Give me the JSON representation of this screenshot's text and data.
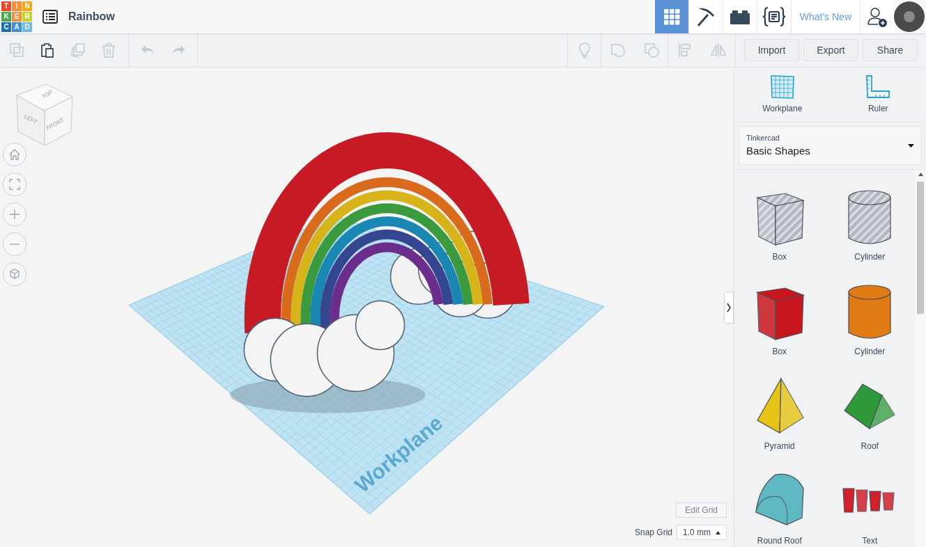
{
  "logo": {
    "letters": [
      "T",
      "I",
      "N",
      "K",
      "E",
      "R",
      "C",
      "A",
      "D"
    ]
  },
  "design_title": "Rainbow",
  "nav_tabs": [
    {
      "kind": "grid",
      "selected": true
    },
    {
      "kind": "pickaxe",
      "selected": false
    },
    {
      "kind": "brick",
      "selected": false
    },
    {
      "kind": "code",
      "selected": false
    }
  ],
  "whats_new": "What's New",
  "edit_tools": [
    {
      "kind": "copy",
      "disabled": true
    },
    {
      "kind": "paste",
      "disabled": false
    },
    {
      "kind": "duplicate",
      "disabled": true
    },
    {
      "kind": "delete",
      "disabled": true
    },
    {
      "kind": "undo",
      "disabled": true
    },
    {
      "kind": "redo",
      "disabled": true
    }
  ],
  "shape_tools": [
    {
      "kind": "bulb",
      "disabled": true
    },
    {
      "kind": "group",
      "disabled": true
    },
    {
      "kind": "ungroup",
      "disabled": true
    },
    {
      "kind": "align",
      "disabled": true
    },
    {
      "kind": "mirror",
      "disabled": true
    }
  ],
  "actions": [
    "Import",
    "Export",
    "Share"
  ],
  "view_cube": {
    "top": "TOP",
    "left": "LEFT",
    "front": "FRONT"
  },
  "view_controls": [
    {
      "kind": "home"
    },
    {
      "kind": "fit"
    },
    {
      "kind": "zoom-in"
    },
    {
      "kind": "zoom-out"
    },
    {
      "kind": "perspective"
    }
  ],
  "workplane_label": "Workplane",
  "edit_grid": "Edit Grid",
  "snap_grid": {
    "label": "Snap Grid",
    "value": "1.0 mm"
  },
  "panel_tools": [
    {
      "kind": "workplane",
      "label": "Workplane"
    },
    {
      "kind": "ruler",
      "label": "Ruler"
    }
  ],
  "library": {
    "source": "Tinkercad",
    "value": "Basic Shapes"
  },
  "shapes": [
    {
      "kind": "box",
      "label": "Box",
      "hole": true,
      "color": "#b4bac3"
    },
    {
      "kind": "cylinder",
      "label": "Cylinder",
      "hole": true,
      "color": "#b4bac3"
    },
    {
      "kind": "box",
      "label": "Box",
      "hole": false,
      "color": "#c8161d"
    },
    {
      "kind": "cylinder",
      "label": "Cylinder",
      "hole": false,
      "color": "#e07a12"
    },
    {
      "kind": "pyramid",
      "label": "Pyramid",
      "hole": false,
      "color": "#e6c314"
    },
    {
      "kind": "roof",
      "label": "Roof",
      "hole": false,
      "color": "#2e9a3a"
    },
    {
      "kind": "roundroof",
      "label": "Round Roof",
      "hole": false,
      "color": "#5fb9c4"
    },
    {
      "kind": "text",
      "label": "Text",
      "hole": false,
      "color": "#d1222b"
    }
  ]
}
